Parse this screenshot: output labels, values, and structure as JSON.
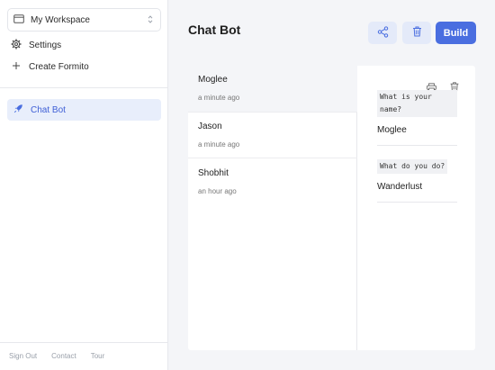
{
  "sidebar": {
    "workspace": {
      "label": "My Workspace",
      "icon": "folder-icon"
    },
    "nav": [
      {
        "label": "Settings",
        "icon": "gear-icon"
      },
      {
        "label": "Create Formito",
        "icon": "plus-icon"
      }
    ],
    "bots": [
      {
        "label": "Chat Bot",
        "icon": "rocket-icon"
      }
    ],
    "footer": {
      "sign_out": "Sign Out",
      "contact": "Contact",
      "tour": "Tour"
    }
  },
  "header": {
    "title": "Chat Bot",
    "build_label": "Build"
  },
  "responses": [
    {
      "name": "Moglee",
      "time": "a minute ago"
    },
    {
      "name": "Jason",
      "time": "a minute ago"
    },
    {
      "name": "Shobhit",
      "time": "an hour ago"
    }
  ],
  "detail": {
    "items": [
      {
        "question": "What is your name?",
        "answer": "Moglee"
      },
      {
        "question": "What do you do?",
        "answer": "Wanderlust"
      }
    ]
  },
  "colors": {
    "accent": "#4a6ee0",
    "accent_light": "#e4eaf9",
    "active_nav_bg": "#e8eefb",
    "active_nav_text": "#3f5fd6",
    "background": "#f4f5f8"
  }
}
